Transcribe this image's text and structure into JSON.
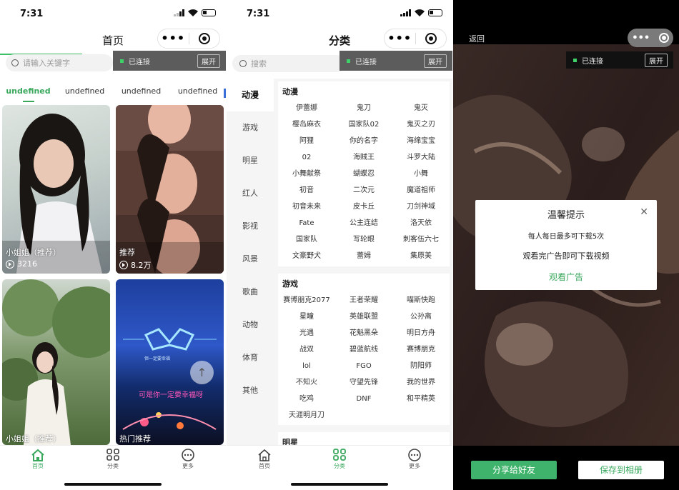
{
  "connection": {
    "status": "已连接",
    "expand": "展开"
  },
  "screen1": {
    "time": "7:31",
    "title": "首页",
    "search_placeholder": "请输入关键字",
    "tabs": [
      "undefined",
      "undefined",
      "undefined",
      "undefined"
    ],
    "cards": [
      {
        "caption": "小姐姐（推荐）",
        "views": "3216"
      },
      {
        "caption": "推荐",
        "views": "8.2万"
      },
      {
        "caption": "小姐姐（推荐）"
      },
      {
        "caption": "热门推荐",
        "overlay_text": "可是你一定要幸福呀",
        "overlay_subtext": "但一定要幸福"
      }
    ],
    "nav": [
      "首页",
      "分类",
      "更多"
    ]
  },
  "screen2": {
    "time": "7:31",
    "title": "分类",
    "search_placeholder": "搜索",
    "sidebar": [
      "动漫",
      "游戏",
      "明星",
      "红人",
      "影视",
      "风景",
      "歌曲",
      "动物",
      "体育",
      "其他"
    ],
    "sections": [
      {
        "title": "动漫",
        "items": [
          "伊蕾娜",
          "鬼刀",
          "鬼灭",
          "樱岛麻衣",
          "国家队02",
          "鬼灭之刃",
          "阿狸",
          "你的名字",
          "海绵宝宝",
          "02",
          "海贼王",
          "斗罗大陆",
          "小舞献祭",
          "蝴蝶忍",
          "小舞",
          "初音",
          "二次元",
          "魔道祖师",
          "初音未来",
          "皮卡丘",
          "刀剑神域",
          "Fate",
          "公主连结",
          "洛天依",
          "国家队",
          "写轮眼",
          "刺客伍六七",
          "文豪野犬",
          "蕾姆",
          "集原美"
        ]
      },
      {
        "title": "游戏",
        "items": [
          "赛博朋克2077",
          "王者荣耀",
          "喵斯快跑",
          "星瞳",
          "英雄联盟",
          "公孙离",
          "光遇",
          "花魁黑朵",
          "明日方舟",
          "战双",
          "碧蓝航线",
          "赛博朋克",
          "lol",
          "FGO",
          "阴阳师",
          "不知火",
          "守望先锋",
          "我的世界",
          "吃鸡",
          "DNF",
          "和平精英",
          "天涯明月刀"
        ]
      },
      {
        "title": "明星",
        "items": []
      }
    ],
    "nav": [
      "首页",
      "分类",
      "更多"
    ]
  },
  "screen3": {
    "back": "返回",
    "dialog": {
      "title": "温馨提示",
      "line1": "每人每日最多可下载5次",
      "line2": "观看完广告即可下载视频",
      "action": "观看广告"
    },
    "share": "分享给好友",
    "save": "保存到相册"
  },
  "colors": {
    "accent": "#39a85d",
    "conn_bg": "#5c5c5c"
  }
}
